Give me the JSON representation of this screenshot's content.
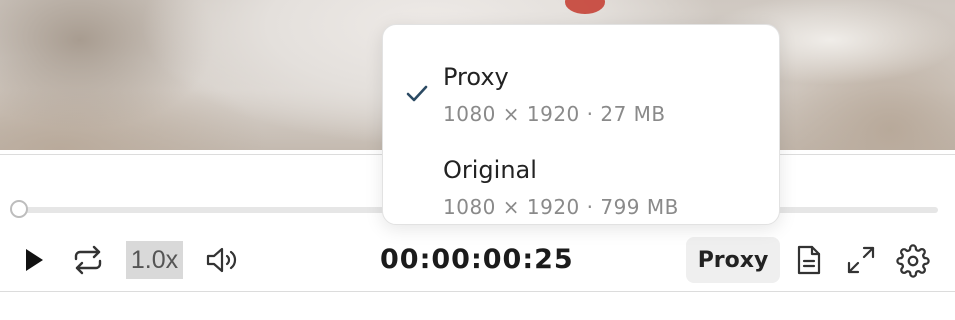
{
  "player": {
    "timecode": "00:00:00:25",
    "speed_label": "1.0x",
    "quality_button_label": "Proxy",
    "playhead_progress": 0.0
  },
  "quality_menu": {
    "selected": "Proxy",
    "options": [
      {
        "label": "Proxy",
        "detail": "1080 × 1920 · 27 MB",
        "checked": true
      },
      {
        "label": "Original",
        "detail": "1080 × 1920 · 799 MB",
        "checked": false
      }
    ]
  },
  "icons": [
    "play-icon",
    "loop-icon",
    "volume-icon",
    "document-icon",
    "expand-icon",
    "gear-icon",
    "checkmark-icon"
  ],
  "colors": {
    "accent": "#2b4a63",
    "speed_bg": "#d9d9d9",
    "proxy_bg": "#efefef"
  }
}
